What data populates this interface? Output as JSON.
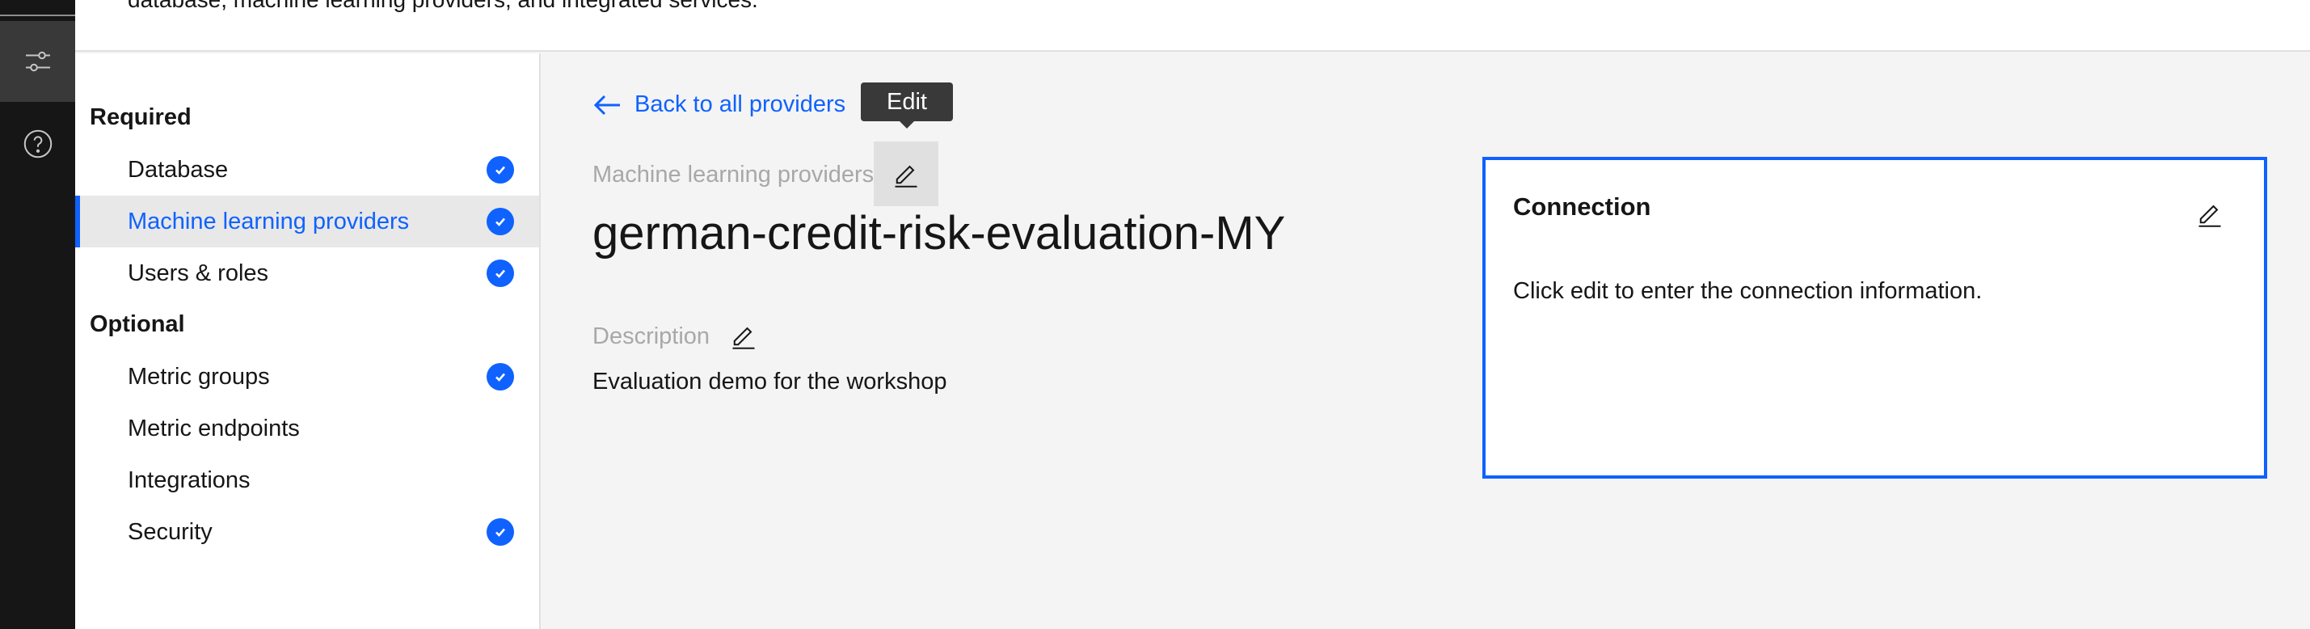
{
  "top_banner": {
    "text": "database, machine learning providers, and integrated services."
  },
  "rail": {
    "items": [
      {
        "icon": "settings-adjust-icon",
        "active": true
      },
      {
        "icon": "help-icon",
        "active": false
      }
    ]
  },
  "sidenav": {
    "required_heading": "Required",
    "optional_heading": "Optional",
    "required_items": [
      {
        "label": "Database",
        "checked": true
      },
      {
        "label": "Machine learning providers",
        "checked": true,
        "selected": true
      },
      {
        "label": "Users & roles",
        "checked": true
      }
    ],
    "optional_items": [
      {
        "label": "Metric groups",
        "checked": true
      },
      {
        "label": "Metric endpoints",
        "checked": false
      },
      {
        "label": "Integrations",
        "checked": false
      },
      {
        "label": "Security",
        "checked": true
      }
    ]
  },
  "main": {
    "back_link": "Back to all providers",
    "tooltip": "Edit",
    "provider_type_label": "Machine learning providers",
    "provider_name": "german-credit-risk-evaluation-MY",
    "description_label": "Description",
    "description_value": "Evaluation demo for the workshop"
  },
  "connection": {
    "title": "Connection",
    "text": "Click edit to enter the connection information."
  },
  "colors": {
    "accent": "#0f62fe",
    "rail": "#161616",
    "background": "#f4f4f4"
  }
}
